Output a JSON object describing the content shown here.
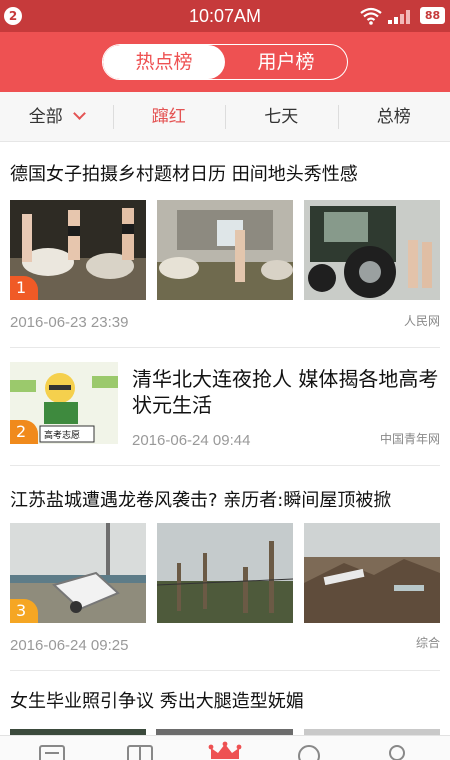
{
  "status": {
    "notification_count": "2",
    "time": "10:07AM",
    "battery": "88"
  },
  "header": {
    "tabs": [
      "热点榜",
      "用户榜"
    ],
    "active_tab": "热点榜"
  },
  "filters": [
    {
      "label": "全部",
      "has_dropdown": true,
      "active": false
    },
    {
      "label": "蹿红",
      "active": true
    },
    {
      "label": "七天",
      "active": false
    },
    {
      "label": "总榜",
      "active": false
    }
  ],
  "news": [
    {
      "rank": "1",
      "title": "德国女子拍摄乡村题材日历 田间地头秀性感",
      "date": "2016-06-23 23:39",
      "source": "人民网",
      "rank_color": "#f05a26"
    },
    {
      "rank": "2",
      "title": "清华北大连夜抢人 媒体揭各地高考状元生活",
      "date": "2016-06-24 09:44",
      "source": "中国青年网",
      "rank_color": "#f08a1c",
      "thumb_label": "高考志愿"
    },
    {
      "rank": "3",
      "title": "江苏盐城遭遇龙卷风袭击? 亲历者:瞬间屋顶被掀",
      "date": "2016-06-24 09:25",
      "source": "综合",
      "rank_color": "#f5a623"
    },
    {
      "title": "女生毕业照引争议 秀出大腿造型妩媚"
    }
  ],
  "tabbar": [
    "news-icon",
    "book-icon",
    "crown-icon",
    "discover-icon",
    "profile-icon"
  ]
}
